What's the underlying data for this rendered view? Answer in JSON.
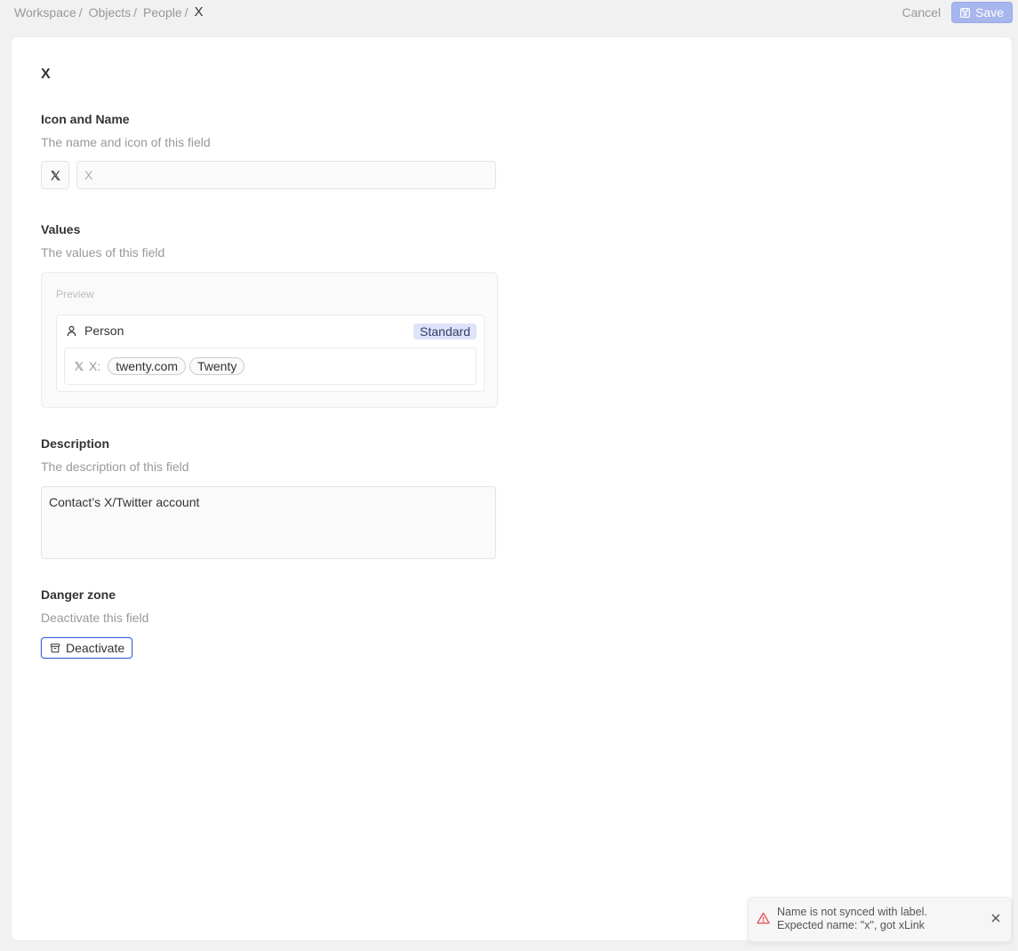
{
  "breadcrumb": {
    "items": [
      "Workspace",
      "Objects",
      "People"
    ],
    "current": "X"
  },
  "actions": {
    "cancel_label": "Cancel",
    "save_label": "Save"
  },
  "page": {
    "title": "X"
  },
  "icon_and_name": {
    "title": "Icon and Name",
    "description": "The name and icon of this field",
    "icon": "x-logo-icon",
    "name_placeholder": "X"
  },
  "values": {
    "title": "Values",
    "description": "The values of this field",
    "preview_label": "Preview",
    "record": {
      "object_name": "Person",
      "badge": "Standard",
      "field_label": "X:",
      "chips": [
        "twenty.com",
        "Twenty"
      ]
    }
  },
  "description_section": {
    "title": "Description",
    "description": "The description of this field",
    "value": "Contact’s X/Twitter account"
  },
  "danger_zone": {
    "title": "Danger zone",
    "description": "Deactivate this field",
    "button_label": "Deactivate"
  },
  "toast": {
    "line1": "Name is not synced with label.",
    "line2": "Expected name: \"x\", got xLink",
    "accent_color": "#e5484d"
  }
}
